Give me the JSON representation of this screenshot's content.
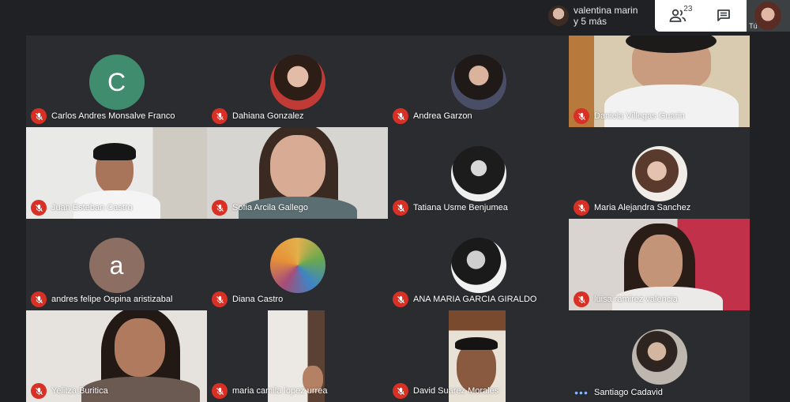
{
  "topbar": {
    "presenter_name": "valentina marin",
    "presenter_more": "y 5 más",
    "people_count": "23",
    "self_label": "Tú"
  },
  "participants": [
    {
      "name": "Carlos Andres Monsalve Franco",
      "initial": "C",
      "avatar_color": "#3f8c6e",
      "type": "initial",
      "mic": "muted"
    },
    {
      "name": "Dahiana Gonzalez",
      "type": "photo",
      "mic": "muted"
    },
    {
      "name": "Andrea Garzon",
      "type": "photo",
      "mic": "muted"
    },
    {
      "name": "Daniela Villegas Guarin",
      "type": "video",
      "mic": "muted"
    },
    {
      "name": "Juan Esteban Castro",
      "type": "video",
      "mic": "muted"
    },
    {
      "name": "Sofia Arcila Gallego",
      "type": "video",
      "mic": "muted"
    },
    {
      "name": "Tatiana Usme Benjumea",
      "type": "photo",
      "mic": "muted"
    },
    {
      "name": "Maria Alejandra Sanchez",
      "type": "photo",
      "mic": "muted"
    },
    {
      "name": "andres felipe Ospina aristizabal",
      "initial": "a",
      "avatar_color": "#8d6e63",
      "type": "initial",
      "mic": "muted"
    },
    {
      "name": "Diana Castro",
      "type": "photo",
      "mic": "muted"
    },
    {
      "name": "ANA MARIA GARCIA GIRALDO",
      "type": "photo",
      "mic": "muted"
    },
    {
      "name": "luisa ramirez valencia",
      "type": "video",
      "mic": "muted"
    },
    {
      "name": "Yelitza Buritica",
      "type": "video",
      "mic": "muted"
    },
    {
      "name": "maria camila lopez urrea",
      "type": "video",
      "mic": "muted"
    },
    {
      "name": "David Suarez Morales",
      "type": "video",
      "mic": "muted"
    },
    {
      "name": "Santiago Cadavid",
      "type": "photo",
      "mic": "speaking"
    }
  ]
}
